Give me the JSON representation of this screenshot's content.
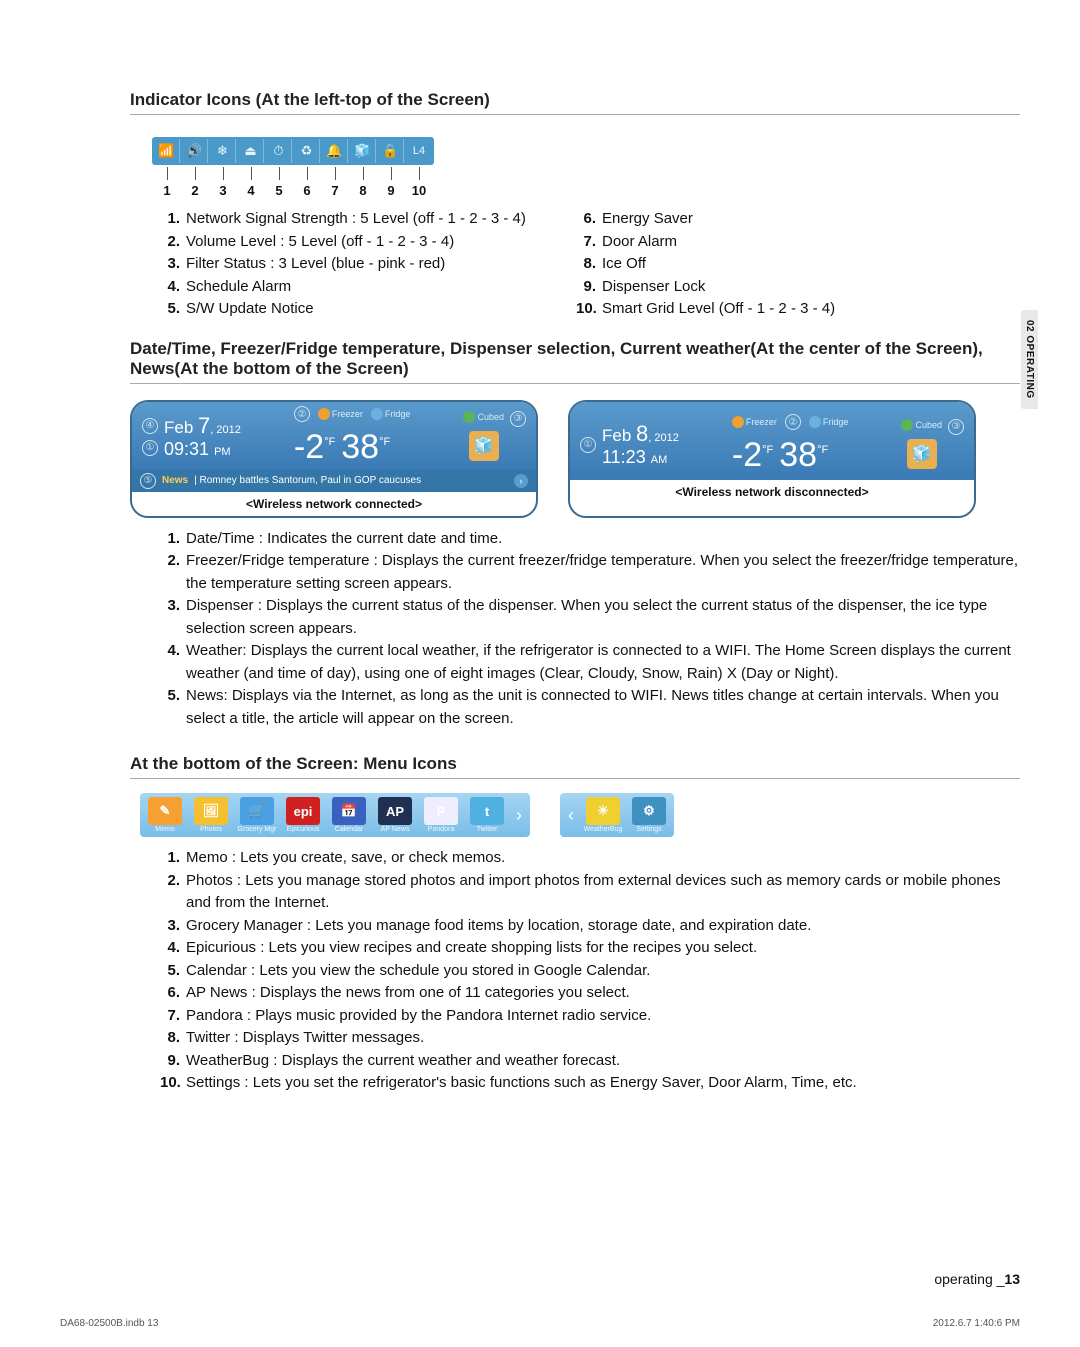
{
  "sideTab": "02 OPERATING",
  "section1": {
    "title": "Indicator Icons (At the left-top of the Screen)",
    "icons": [
      "📶",
      "🔊",
      "❄",
      "⏏",
      "⏱",
      "♻",
      "🔔",
      "🧊",
      "🔒",
      "L4"
    ],
    "nums": [
      "1",
      "2",
      "3",
      "4",
      "5",
      "6",
      "7",
      "8",
      "9",
      "10"
    ],
    "left": [
      {
        "n": "1.",
        "t": "Network Signal Strength : 5 Level (off - 1 - 2 - 3 - 4)"
      },
      {
        "n": "2.",
        "t": "Volume Level : 5 Level (off - 1 - 2 - 3 - 4)"
      },
      {
        "n": "3.",
        "t": "Filter Status : 3 Level (blue - pink - red)"
      },
      {
        "n": "4.",
        "t": "Schedule Alarm"
      },
      {
        "n": "5.",
        "t": "S/W Update Notice"
      }
    ],
    "right": [
      {
        "n": "6.",
        "t": "Energy Saver"
      },
      {
        "n": "7.",
        "t": "Door Alarm"
      },
      {
        "n": "8.",
        "t": "Ice Off"
      },
      {
        "n": "9.",
        "t": "Dispenser Lock"
      },
      {
        "n": "10.",
        "t": "Smart Grid Level (Off - 1 - 2 - 3 - 4)"
      }
    ]
  },
  "section2": {
    "title": "Date/Time, Freezer/Fridge temperature, Dispenser selection, Current weather(At the center of the Screen), News(At the bottom of the Screen)",
    "card1": {
      "a4": "④",
      "a1": "①",
      "a2": "②",
      "a3": "③",
      "a5": "⑤",
      "dateMonth": "Feb ",
      "dateDay": "7",
      "dateYear": ", 2012",
      "time": "09:31",
      "ampm": "PM",
      "freezerLbl": "Freezer",
      "fridgeLbl": "Fridge",
      "cubedLbl": "Cubed",
      "t1": "-2",
      "t2": "38",
      "unit": "°F",
      "newsLabel": "News",
      "newsText": "| Romney battles Santorum, Paul in GOP caucuses",
      "caption": "<Wireless network connected>"
    },
    "card2": {
      "a1": "①",
      "a2": "②",
      "a3": "③",
      "dateMonth": "Feb ",
      "dateDay": "8",
      "dateYear": ", 2012",
      "time": "11:23",
      "ampm": "AM",
      "freezerLbl": "Freezer",
      "fridgeLbl": "Fridge",
      "cubedLbl": "Cubed",
      "t1": "-2",
      "t2": "38",
      "unit": "°F",
      "caption": "<Wireless network disconnected>"
    },
    "list": [
      {
        "n": "1.",
        "t": "Date/Time : Indicates the current date and time."
      },
      {
        "n": "2.",
        "t": "Freezer/Fridge temperature : Displays the current freezer/fridge temperature. When you select the freezer/fridge temperature, the temperature setting screen appears."
      },
      {
        "n": "3.",
        "t": "Dispenser : Displays the current status of the dispenser. When you select the current status of the dispenser, the ice type selection screen appears."
      },
      {
        "n": "4.",
        "t": "Weather:  Displays the current local weather, if the refrigerator is connected to a WIFI.  The Home Screen displays  the current weather (and time of day), using one of eight images (Clear, Cloudy, Snow, Rain) X (Day or Night)."
      },
      {
        "n": "5.",
        "t": "News:  Displays via the Internet, as long as the unit is connected to WIFI.  News titles change at certain intervals.  When you select a title, the article will appear on the screen."
      }
    ]
  },
  "section3": {
    "title": "At the bottom of the Screen: Menu Icons",
    "bar1": [
      {
        "label": "Memo",
        "color": "#f5a030",
        "txt": "✎"
      },
      {
        "label": "Photos",
        "color": "#f5c030",
        "txt": "🖼"
      },
      {
        "label": "Grocery Mgr",
        "color": "#4aa0e0",
        "txt": "🛒"
      },
      {
        "label": "Epicurious",
        "color": "#d02020",
        "txt": "epi"
      },
      {
        "label": "Calendar",
        "color": "#3a60c0",
        "txt": "📅"
      },
      {
        "label": "AP News",
        "color": "#203050",
        "txt": "AP"
      },
      {
        "label": "Pandora",
        "color": "#eef",
        "txt": "P"
      },
      {
        "label": "Twitter",
        "color": "#50b0e0",
        "txt": "t"
      }
    ],
    "bar2": [
      {
        "label": "WeatherBug",
        "color": "#f0d030",
        "txt": "☀"
      },
      {
        "label": "Settings",
        "color": "#4090c0",
        "txt": "⚙"
      }
    ],
    "list": [
      {
        "n": "1.",
        "t": "Memo : Lets you create, save, or check memos."
      },
      {
        "n": "2.",
        "t": "Photos : Lets you manage stored photos and import photos from external devices such as memory cards or mobile phones and from the Internet."
      },
      {
        "n": "3.",
        "t": "Grocery Manager : Lets you manage food items by location, storage date, and expiration date."
      },
      {
        "n": "4.",
        "t": "Epicurious : Lets you view recipes and create shopping lists for the recipes you select."
      },
      {
        "n": "5.",
        "t": "Calendar : Lets you view the schedule you stored in Google Calendar."
      },
      {
        "n": "6.",
        "t": "AP News : Displays the news from one of 11 categories you select."
      },
      {
        "n": "7.",
        "t": "Pandora : Plays music provided by the Pandora Internet radio service."
      },
      {
        "n": "8.",
        "t": "Twitter : Displays Twitter messages."
      },
      {
        "n": "9.",
        "t": "WeatherBug : Displays the current weather and weather forecast."
      },
      {
        "n": "10.",
        "t": "Settings : Lets you set the refrigerator's basic functions such as Energy Saver, Door Alarm, Time, etc."
      }
    ]
  },
  "footer": {
    "label": "operating _",
    "page": "13"
  },
  "printFooter": {
    "left": "DA68-02500B.indb   13",
    "right": "2012.6.7   1:40:6 PM"
  }
}
